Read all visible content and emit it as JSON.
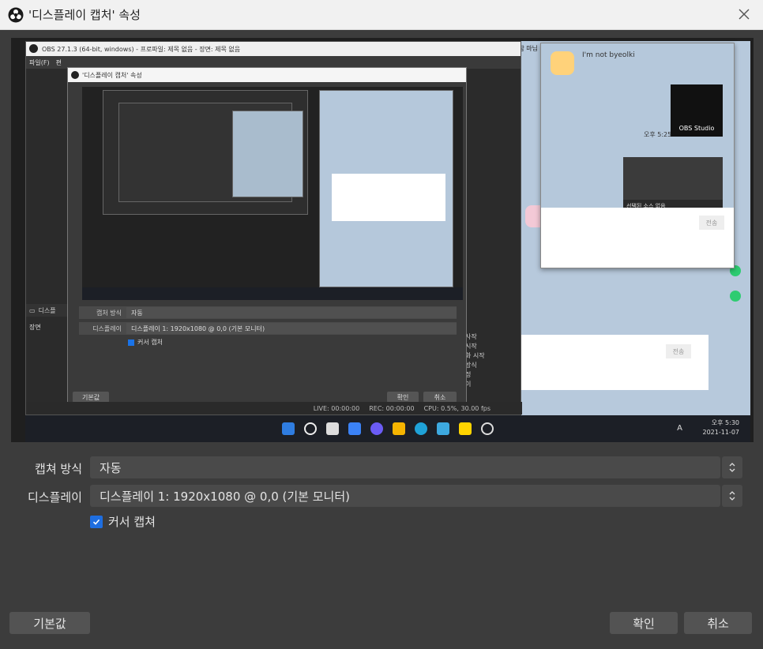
{
  "window": {
    "title": "'디스플레이 캡처' 속성",
    "close_glyph": "✕"
  },
  "preview": {
    "obs_window_title": "OBS 27.1.3 (64-bit, windows) - 프로파일: 제목 없음 - 장면: 제목 없음",
    "menu_items": [
      "파일(F)",
      "편"
    ],
    "inner_dialog_title": "'디스플레이 캡처' 속성",
    "inner_capture_method_label": "캡처 방식",
    "inner_capture_method_value": "자동",
    "inner_display_label": "디스플레이",
    "inner_display_value": "디스플레이 1: 1920x1080 @ 0,0 (기본 모니터)",
    "inner_cursor_label": "커서 캡처",
    "inner_defaults": "기본값",
    "inner_ok": "확인",
    "inner_cancel": "취소",
    "scene_header": "장면",
    "scene_tab": "디스플",
    "status_live": "LIVE: 00:00:00",
    "status_rec": "REC: 00:00:00",
    "status_cpu": "CPU: 0.5%, 30.00 fps",
    "side_texts": [
      "사작",
      "시작",
      "화 시작",
      "방식",
      "정",
      "이"
    ],
    "chat_back_header": "사람 마님",
    "chat_name": "I'm not byeolki",
    "chat_obs_label": "OBS Studio",
    "chat_time": "오후 5:25",
    "chat_card_bar": "선택된 소스 없음",
    "chat_send": "전송",
    "tray_time": "오후 5:30",
    "tray_date": "2021-11-07",
    "tray_ime": "A"
  },
  "form": {
    "capture_method_label": "캡쳐 방식",
    "capture_method_value": "자동",
    "display_label": "디스플레이",
    "display_value": "디스플레이 1: 1920x1080 @ 0,0 (기본 모니터)",
    "cursor_capture_label": "커서 캡쳐",
    "cursor_capture_checked": true
  },
  "buttons": {
    "defaults": "기본값",
    "ok": "확인",
    "cancel": "취소"
  },
  "colors": {
    "accent": "#1e6ee0",
    "dialog_bg": "#3c3c3c",
    "combo_bg": "#4a4a4a"
  }
}
